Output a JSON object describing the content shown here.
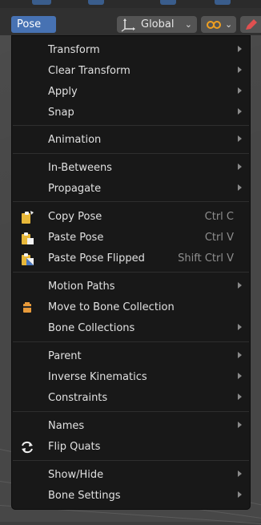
{
  "header": {
    "menu_label": "Pose",
    "orientation_label": "Global",
    "orientation_icon": "transform-axes-icon",
    "pivot_icon": "pivot-link-icon",
    "tool_icon": "pencil-icon"
  },
  "menu": {
    "items": [
      {
        "label": "Transform",
        "arrow": true
      },
      {
        "label": "Clear Transform",
        "arrow": true
      },
      {
        "label": "Apply",
        "arrow": true
      },
      {
        "label": "Snap",
        "arrow": true
      },
      {
        "label": "Animation",
        "arrow": true
      },
      {
        "label": "In-Betweens",
        "arrow": true
      },
      {
        "label": "Propagate",
        "arrow": true
      },
      {
        "label": "Copy Pose",
        "shortcut": "Ctrl C",
        "icon": "copy-pose-icon"
      },
      {
        "label": "Paste Pose",
        "shortcut": "Ctrl V",
        "icon": "paste-pose-icon"
      },
      {
        "label": "Paste Pose Flipped",
        "shortcut": "Shift Ctrl V",
        "icon": "paste-pose-flipped-icon"
      },
      {
        "label": "Motion Paths",
        "arrow": true
      },
      {
        "label": "Move to Bone Collection",
        "icon": "bone-collection-icon"
      },
      {
        "label": "Bone Collections",
        "arrow": true
      },
      {
        "label": "Parent",
        "arrow": true
      },
      {
        "label": "Inverse Kinematics",
        "arrow": true
      },
      {
        "label": "Constraints",
        "arrow": true
      },
      {
        "label": "Names",
        "arrow": true
      },
      {
        "label": "Flip Quats",
        "icon": "flip-quats-icon"
      },
      {
        "label": "Show/Hide",
        "arrow": true
      },
      {
        "label": "Bone Settings",
        "arrow": true
      }
    ]
  },
  "colors": {
    "accent": "#4772b3",
    "menu_bg": "#181818",
    "copy_icon": "#e8b83a",
    "collection_icon": "#e89a3a"
  }
}
